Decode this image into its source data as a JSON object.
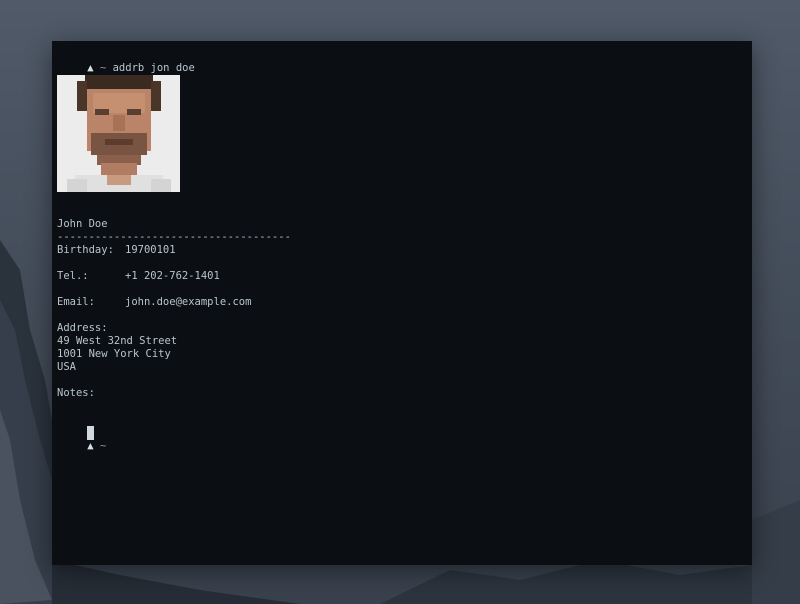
{
  "terminal": {
    "command_prompt_symbol": "▲",
    "command_prompt_dir": "~",
    "command": "addrb jon doe",
    "contact": {
      "name": "John Doe",
      "separator": "-------------------------------------",
      "birthday_label": "Birthday:",
      "birthday_value": "19700101",
      "tel_label": "Tel.:",
      "tel_value": "+1 202-762-1401",
      "email_label": "Email:",
      "email_value": "john.doe@example.com",
      "address_label": "Address:",
      "address_line1": "49 West 32nd Street",
      "address_line2": "1001 New York City",
      "address_line3": "USA",
      "notes_label": "Notes:"
    },
    "photo_icon": "contact-photo",
    "next_prompt_symbol": "▲",
    "next_prompt_dir": "~"
  },
  "colors": {
    "terminal_bg": "#0b0e12",
    "text": "#b8c6cc"
  }
}
